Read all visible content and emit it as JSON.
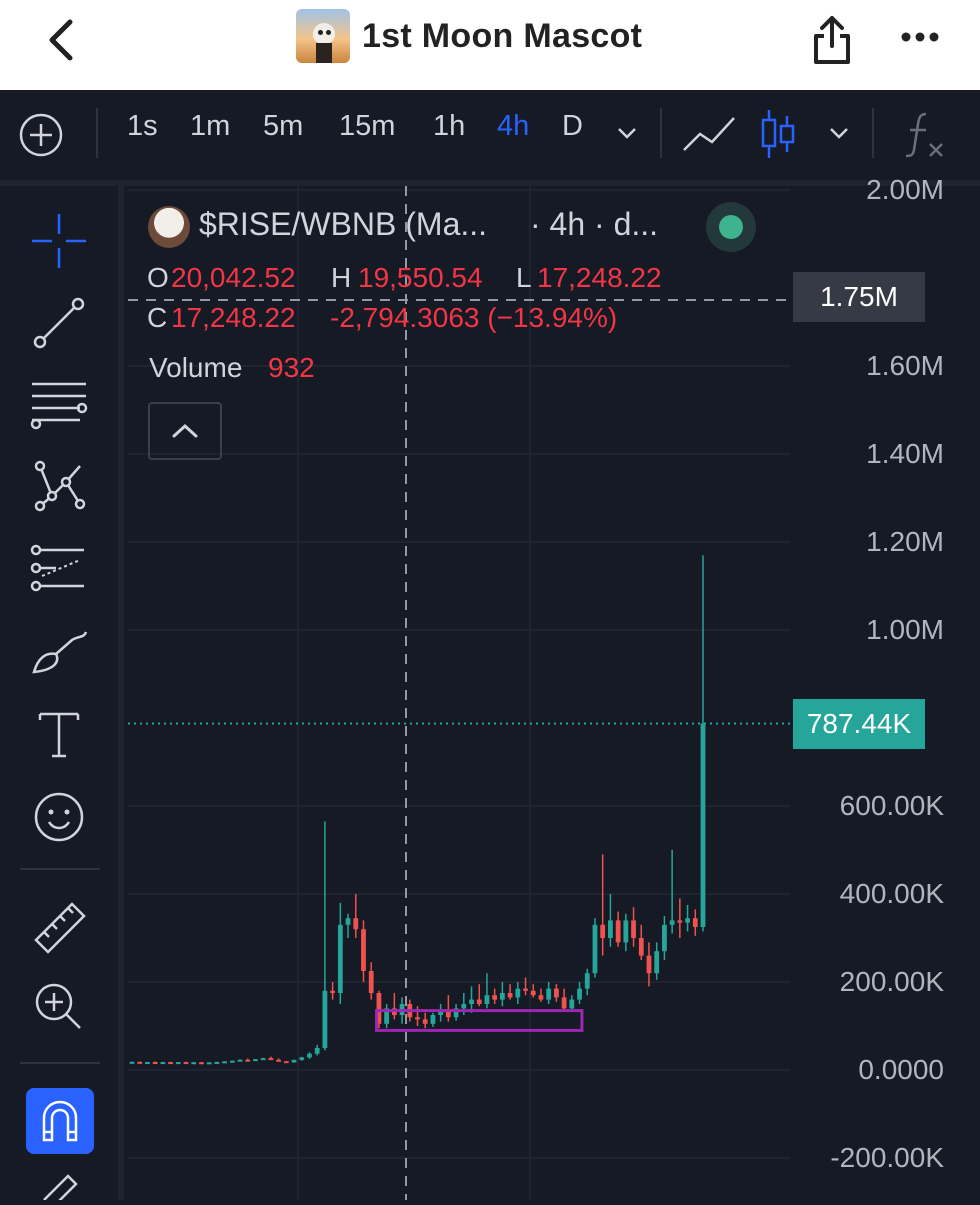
{
  "header": {
    "title": "1st Moon Mascot"
  },
  "toolbar": {
    "intervals": [
      "1s",
      "1m",
      "5m",
      "15m",
      "1h",
      "4h",
      "D"
    ],
    "active_interval": "4h"
  },
  "legend": {
    "symbol": "$RISE/WBNB (Ma...",
    "interval_text": "· 4h · d...",
    "o_label": "O",
    "o_value": "20,042.52",
    "h_label": "H",
    "h_value": "19,550.54",
    "l_label": "L",
    "l_value": "17,248.22",
    "c_label": "C",
    "c_value": "17,248.22",
    "change": "-2,794.3063 (−13.94%)",
    "volume_label": "Volume",
    "volume_value": "932"
  },
  "price_tags": {
    "crosshair": "1.75M",
    "last": "787.44K"
  },
  "colors": {
    "up": "#26a69a",
    "down": "#ef5350",
    "accent": "#2962ff",
    "box": "#9c27b0"
  },
  "chart_data": {
    "type": "candlestick",
    "y_tick_labels": [
      "2.00M",
      "1.60M",
      "1.40M",
      "1.20M",
      "1.00M",
      "600.00K",
      "400.00K",
      "200.00K",
      "0.0000",
      "-200.00K"
    ],
    "y_ticks": [
      2000000,
      1600000,
      1400000,
      1200000,
      1000000,
      600000,
      400000,
      200000,
      0,
      -200000
    ],
    "ylim": [
      -215000,
      2005000
    ],
    "crosshair_value": 1750000,
    "last_price": 787440,
    "box": {
      "start": 32,
      "end": 58,
      "low": 90000,
      "high": 135000
    },
    "candles": [
      {
        "o": 18000,
        "h": 19000,
        "l": 17000,
        "c": 18500
      },
      {
        "o": 18500,
        "h": 19200,
        "l": 17500,
        "c": 17800
      },
      {
        "o": 17800,
        "h": 18500,
        "l": 16900,
        "c": 18200
      },
      {
        "o": 18200,
        "h": 19500,
        "l": 17800,
        "c": 17500
      },
      {
        "o": 17500,
        "h": 18400,
        "l": 16800,
        "c": 18000
      },
      {
        "o": 18000,
        "h": 18800,
        "l": 17400,
        "c": 17300
      },
      {
        "o": 17300,
        "h": 18100,
        "l": 16500,
        "c": 17900
      },
      {
        "o": 17900,
        "h": 19100,
        "l": 17200,
        "c": 17000
      },
      {
        "o": 17000,
        "h": 18000,
        "l": 16400,
        "c": 17600
      },
      {
        "o": 17600,
        "h": 18300,
        "l": 16900,
        "c": 16800
      },
      {
        "o": 16800,
        "h": 17700,
        "l": 16000,
        "c": 17400
      },
      {
        "o": 17400,
        "h": 18600,
        "l": 16700,
        "c": 18300
      },
      {
        "o": 18300,
        "h": 19900,
        "l": 17900,
        "c": 19700
      },
      {
        "o": 19700,
        "h": 21500,
        "l": 19000,
        "c": 21100
      },
      {
        "o": 21100,
        "h": 23800,
        "l": 20400,
        "c": 23400
      },
      {
        "o": 23400,
        "h": 26000,
        "l": 22600,
        "c": 22500
      },
      {
        "o": 22500,
        "h": 25000,
        "l": 21800,
        "c": 24700
      },
      {
        "o": 24700,
        "h": 27600,
        "l": 24000,
        "c": 27000
      },
      {
        "o": 27000,
        "h": 30400,
        "l": 26100,
        "c": 23300
      },
      {
        "o": 23300,
        "h": 26300,
        "l": 21700,
        "c": 20042
      },
      {
        "o": 20042,
        "h": 19550,
        "l": 17248,
        "c": 17248
      },
      {
        "o": 17248,
        "h": 23600,
        "l": 16500,
        "c": 22900
      },
      {
        "o": 22900,
        "h": 30000,
        "l": 21000,
        "c": 28600
      },
      {
        "o": 28600,
        "h": 40000,
        "l": 25500,
        "c": 37000
      },
      {
        "o": 37000,
        "h": 57000,
        "l": 33000,
        "c": 50000
      },
      {
        "o": 50000,
        "h": 565000,
        "l": 45000,
        "c": 180000
      },
      {
        "o": 180000,
        "h": 200000,
        "l": 160000,
        "c": 175000
      },
      {
        "o": 175000,
        "h": 380000,
        "l": 150000,
        "c": 330000
      },
      {
        "o": 330000,
        "h": 355000,
        "l": 300000,
        "c": 345000
      },
      {
        "o": 345000,
        "h": 400000,
        "l": 300000,
        "c": 320000
      },
      {
        "o": 320000,
        "h": 340000,
        "l": 200000,
        "c": 225000
      },
      {
        "o": 225000,
        "h": 245000,
        "l": 160000,
        "c": 175000
      },
      {
        "o": 175000,
        "h": 180000,
        "l": 95000,
        "c": 105000
      },
      {
        "o": 105000,
        "h": 150000,
        "l": 95000,
        "c": 140000
      },
      {
        "o": 140000,
        "h": 175000,
        "l": 115000,
        "c": 125000
      },
      {
        "o": 125000,
        "h": 165000,
        "l": 105000,
        "c": 150000
      },
      {
        "o": 150000,
        "h": 160000,
        "l": 110000,
        "c": 120000
      },
      {
        "o": 120000,
        "h": 145000,
        "l": 100000,
        "c": 115000
      },
      {
        "o": 115000,
        "h": 130000,
        "l": 95000,
        "c": 105000
      },
      {
        "o": 105000,
        "h": 130000,
        "l": 98000,
        "c": 125000
      },
      {
        "o": 125000,
        "h": 150000,
        "l": 110000,
        "c": 135000
      },
      {
        "o": 135000,
        "h": 170000,
        "l": 110000,
        "c": 120000
      },
      {
        "o": 120000,
        "h": 150000,
        "l": 112000,
        "c": 140000
      },
      {
        "o": 140000,
        "h": 175000,
        "l": 125000,
        "c": 150000
      },
      {
        "o": 150000,
        "h": 190000,
        "l": 130000,
        "c": 160000
      },
      {
        "o": 160000,
        "h": 195000,
        "l": 145000,
        "c": 150000
      },
      {
        "o": 150000,
        "h": 220000,
        "l": 140000,
        "c": 170000
      },
      {
        "o": 170000,
        "h": 185000,
        "l": 150000,
        "c": 160000
      },
      {
        "o": 160000,
        "h": 200000,
        "l": 145000,
        "c": 175000
      },
      {
        "o": 175000,
        "h": 195000,
        "l": 160000,
        "c": 165000
      },
      {
        "o": 165000,
        "h": 200000,
        "l": 150000,
        "c": 185000
      },
      {
        "o": 185000,
        "h": 210000,
        "l": 170000,
        "c": 180000
      },
      {
        "o": 180000,
        "h": 195000,
        "l": 165000,
        "c": 170000
      },
      {
        "o": 170000,
        "h": 185000,
        "l": 155000,
        "c": 160000
      },
      {
        "o": 160000,
        "h": 200000,
        "l": 150000,
        "c": 185000
      },
      {
        "o": 185000,
        "h": 195000,
        "l": 155000,
        "c": 165000
      },
      {
        "o": 165000,
        "h": 185000,
        "l": 135000,
        "c": 140000
      },
      {
        "o": 140000,
        "h": 170000,
        "l": 135000,
        "c": 160000
      },
      {
        "o": 160000,
        "h": 200000,
        "l": 150000,
        "c": 185000
      },
      {
        "o": 185000,
        "h": 230000,
        "l": 170000,
        "c": 220000
      },
      {
        "o": 220000,
        "h": 345000,
        "l": 210000,
        "c": 330000
      },
      {
        "o": 330000,
        "h": 490000,
        "l": 260000,
        "c": 300000
      },
      {
        "o": 300000,
        "h": 400000,
        "l": 280000,
        "c": 340000
      },
      {
        "o": 340000,
        "h": 360000,
        "l": 280000,
        "c": 290000
      },
      {
        "o": 290000,
        "h": 355000,
        "l": 270000,
        "c": 340000
      },
      {
        "o": 340000,
        "h": 370000,
        "l": 280000,
        "c": 300000
      },
      {
        "o": 300000,
        "h": 330000,
        "l": 250000,
        "c": 260000
      },
      {
        "o": 260000,
        "h": 290000,
        "l": 190000,
        "c": 220000
      },
      {
        "o": 220000,
        "h": 290000,
        "l": 205000,
        "c": 270000
      },
      {
        "o": 270000,
        "h": 350000,
        "l": 250000,
        "c": 330000
      },
      {
        "o": 330000,
        "h": 500000,
        "l": 310000,
        "c": 340000
      },
      {
        "o": 340000,
        "h": 390000,
        "l": 300000,
        "c": 335000
      },
      {
        "o": 335000,
        "h": 375000,
        "l": 315000,
        "c": 345000
      },
      {
        "o": 345000,
        "h": 365000,
        "l": 305000,
        "c": 325000
      },
      {
        "o": 325000,
        "h": 1170000,
        "l": 315000,
        "c": 787440
      }
    ]
  }
}
